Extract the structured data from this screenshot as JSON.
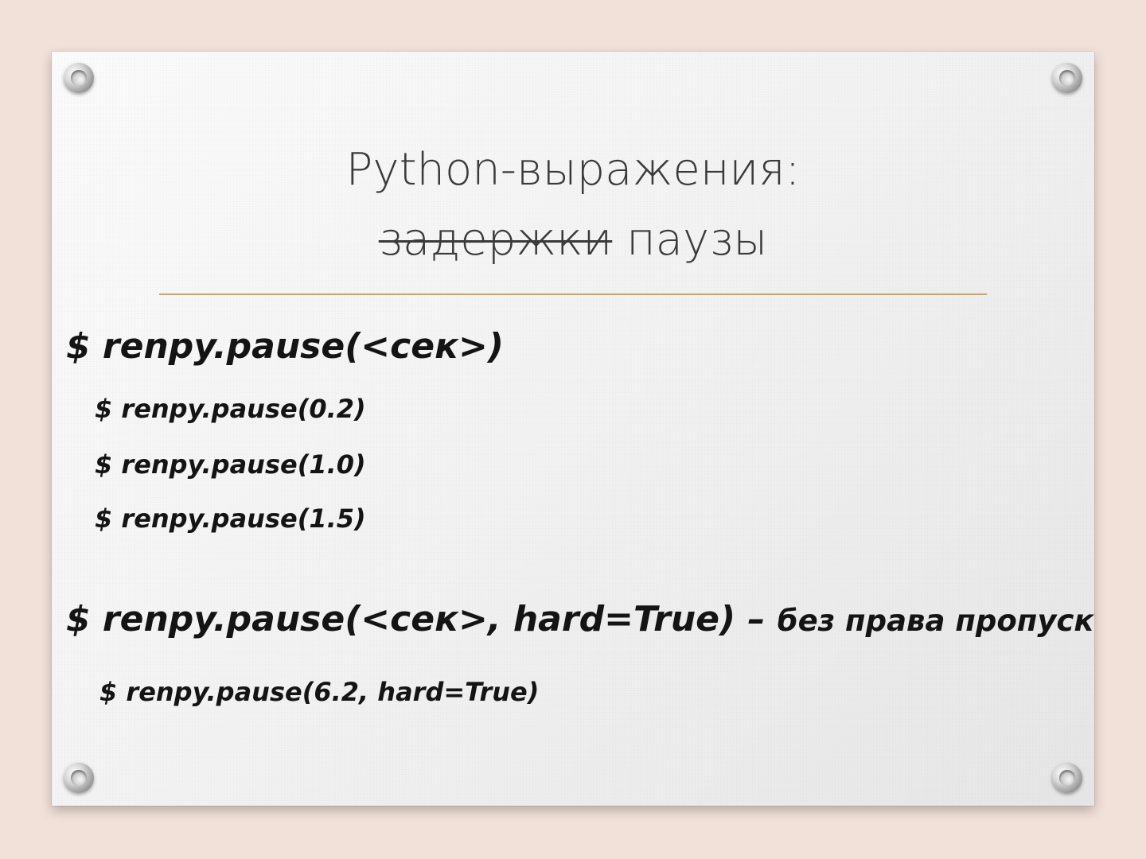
{
  "slide": {
    "title": {
      "line1": "Python-выражения:",
      "struck_word": "задержки",
      "replacement_word": "паузы"
    },
    "section1": {
      "syntax": "$ renpy.pause(<сек>)",
      "examples": [
        "$ renpy.pause(0.2)",
        "$ renpy.pause(1.0)",
        "$ renpy.pause(1.5)"
      ]
    },
    "section2": {
      "syntax": "$ renpy.pause(<сек>, hard=True)",
      "dash": " – ",
      "note": "без права пропуска",
      "example": "$ renpy.pause(6.2, hard=True)"
    }
  },
  "colors": {
    "background": "#f2e1d9",
    "divider": "#c4a57a",
    "text": "#141414",
    "title_text": "#3a3a3a"
  }
}
